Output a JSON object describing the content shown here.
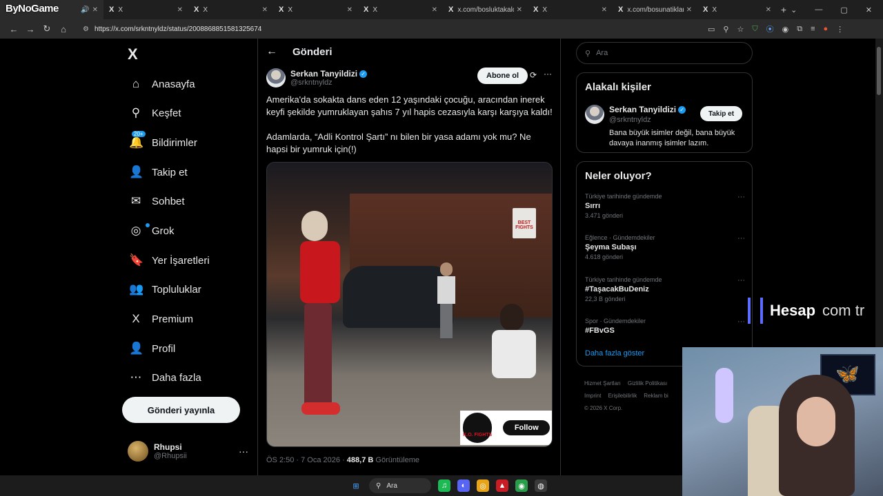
{
  "browser": {
    "overlay_logo": "ByNoGame",
    "tabs": [
      {
        "icon": "",
        "title": "",
        "close": "✕"
      },
      {
        "icon": "X",
        "title": "X",
        "close": "✕"
      },
      {
        "icon": "X",
        "title": "X",
        "close": "✕"
      },
      {
        "icon": "X",
        "title": "X",
        "close": "✕"
      },
      {
        "icon": "X",
        "title": "X",
        "close": "✕"
      },
      {
        "icon": "X",
        "title": "x.com/bosluktakaldı",
        "close": "✕"
      },
      {
        "icon": "X",
        "title": "X",
        "close": "✕"
      },
      {
        "icon": "X",
        "title": "x.com/bosunatiklama",
        "close": "✕"
      },
      {
        "icon": "X",
        "title": "X",
        "close": "✕"
      }
    ],
    "new_tab": "+",
    "url": "https://x.com/srkntnyldz/status/2008868851581325674"
  },
  "nav": {
    "logo": "X",
    "items": [
      {
        "label": "Anasayfa",
        "icon": "⌂"
      },
      {
        "label": "Keşfet",
        "icon": "⚲"
      },
      {
        "label": "Bildirimler",
        "icon": "🔔"
      },
      {
        "label": "Takip et",
        "icon": "👤"
      },
      {
        "label": "Sohbet",
        "icon": "✉"
      },
      {
        "label": "Grok",
        "icon": "◎"
      },
      {
        "label": "Yer İşaretleri",
        "icon": "🔖"
      },
      {
        "label": "Topluluklar",
        "icon": "👥"
      },
      {
        "label": "Premium",
        "icon": "X"
      },
      {
        "label": "Profil",
        "icon": "👤"
      },
      {
        "label": "Daha fazla",
        "icon": "⋯"
      }
    ],
    "notif_badge": "20+",
    "post_button": "Gönderi yayınla",
    "account": {
      "name": "Rhupsi",
      "handle": "@Rhupsii",
      "more": "···"
    }
  },
  "post": {
    "header": "Gönderi",
    "author_name": "Serkan Tanyildizi",
    "author_handle": "@srkntnyldz",
    "subscribe": "Abone ol",
    "text_1": "Amerika'da sokakta dans eden 12 yaşındaki çocuğu, aracından inerek keyfi şekilde yumruklayan şahıs 7 yıl hapis cezasıyla karşı karşıya kaldı!",
    "text_2": "Adamlarda, “Adli Kontrol Şartı” nı bilen bir yasa adamı yok mu? Ne hapsi bir yumruk için(!)",
    "video_sign": "BEST FIGHTS",
    "video_logo": "K.O. FIGHTS",
    "video_follow": "Follow",
    "time": "ÖS 2:50 · 7 Oca 2026 ·",
    "views": "488,7 B",
    "views_label": "Görüntüleme"
  },
  "sidebar": {
    "search_placeholder": "Ara",
    "related_title": "Alakalı kişiler",
    "related": {
      "name": "Serkan Tanyildizi",
      "handle": "@srkntnyldz",
      "bio": "Bana büyük isimler değil, bana büyük davaya inanmış isimler lazım.",
      "follow": "Takip et"
    },
    "trends_title": "Neler oluyor?",
    "trends": [
      {
        "context": "Türkiye tarihinde gündemde",
        "name": "Sırrı",
        "count": "3.471 gönderi"
      },
      {
        "context": "Eğlence · Gündemdekiler",
        "name": "Şeyma Subaşı",
        "count": "4.618 gönderi"
      },
      {
        "context": "Türkiye tarihinde gündemde",
        "name": "#TaşacakBuDeniz",
        "count": "22,3 B gönderi"
      },
      {
        "context": "Spor · Gündemdekiler",
        "name": "#FBvGS",
        "count": ""
      }
    ],
    "show_more": "Daha fazla göster",
    "footer": [
      "Hizmet Şartları",
      "Gizlilik Politikası",
      "Imprint",
      "Erişilebilirlik",
      "Reklam bi",
      "© 2026 X Corp."
    ]
  },
  "overlay": {
    "hesap_1": "Hesap",
    "hesap_2": "com tr"
  },
  "taskbar": {
    "search": "Ara"
  }
}
